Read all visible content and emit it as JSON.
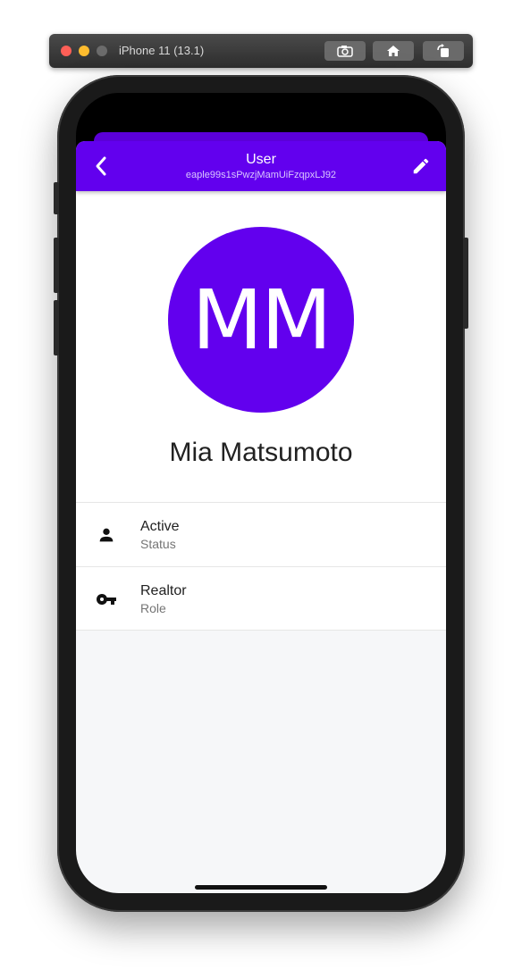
{
  "simulator": {
    "device_title": "iPhone 11 (13.1)",
    "buttons": [
      {
        "icon": "screenshot-icon"
      },
      {
        "icon": "home-icon"
      },
      {
        "icon": "rotate-icon"
      }
    ]
  },
  "appbar": {
    "title": "User",
    "subtitle": "eaple99s1sPwzjMamUiFzqpxLJ92",
    "back_icon": "chevron-left-icon",
    "edit_icon": "pencil-icon",
    "color": "#6200ee"
  },
  "profile": {
    "initials": "MM",
    "name": "Mia Matsumoto",
    "avatar_color": "#6200ee"
  },
  "details": [
    {
      "icon": "person-icon",
      "primary": "Active",
      "secondary": "Status"
    },
    {
      "icon": "key-icon",
      "primary": "Realtor",
      "secondary": "Role"
    }
  ]
}
